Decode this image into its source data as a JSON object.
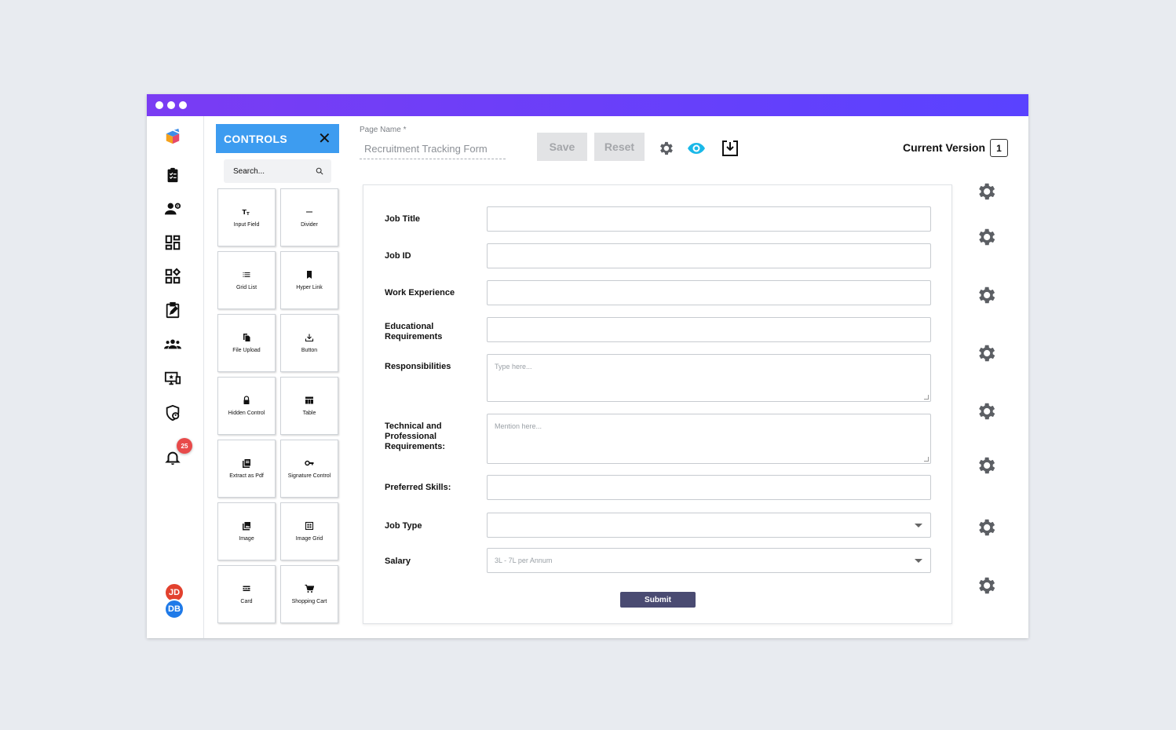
{
  "window": {
    "accent": "#6a3ef8"
  },
  "rail": {
    "icons": [
      "app-logo-icon",
      "clipboard-checklist-icon",
      "user-settings-icon",
      "dashboard-icon",
      "widgets-icon",
      "edit-task-icon",
      "team-icon",
      "monitor-star-icon",
      "shield-user-icon",
      "bell-icon"
    ],
    "notification_count": "25",
    "avatars": [
      {
        "initials": "JD",
        "color": "#e2412e"
      },
      {
        "initials": "DB",
        "color": "#1f7ae8"
      }
    ]
  },
  "controls": {
    "title": "CONTROLS",
    "close_icon": "close-icon",
    "search_placeholder": "Search...",
    "items": [
      {
        "label": "Input Field",
        "icon": "text-icon"
      },
      {
        "label": "Divider",
        "icon": "divider-icon"
      },
      {
        "label": "Grid List",
        "icon": "list-icon"
      },
      {
        "label": "Hyper Link",
        "icon": "bookmark-icon"
      },
      {
        "label": "File Upload",
        "icon": "file-copy-icon"
      },
      {
        "label": "Button",
        "icon": "download-icon"
      },
      {
        "label": "Hidden Control",
        "icon": "lock-icon"
      },
      {
        "label": "Table",
        "icon": "table-icon"
      },
      {
        "label": "Extract as Pdf",
        "icon": "pdf-icon"
      },
      {
        "label": "Signature Control",
        "icon": "key-icon"
      },
      {
        "label": "Image",
        "icon": "image-icon"
      },
      {
        "label": "Image Grid",
        "icon": "image-grid-icon"
      },
      {
        "label": "Card",
        "icon": "card-icon"
      },
      {
        "label": "Shopping Cart",
        "icon": "cart-icon"
      }
    ]
  },
  "toolbar": {
    "page_name_label": "Page Name *",
    "page_name_value": "Recruitment Tracking Form",
    "save_label": "Save",
    "reset_label": "Reset",
    "icons": [
      "gear-icon",
      "eye-icon",
      "import-icon"
    ],
    "version_label": "Current Version",
    "version_number": "1"
  },
  "form": {
    "fields": [
      {
        "label": "Job Title",
        "type": "input",
        "placeholder": ""
      },
      {
        "label": "Job ID",
        "type": "input",
        "placeholder": ""
      },
      {
        "label": "Work Experience",
        "type": "input",
        "placeholder": ""
      },
      {
        "label": "Educational Requirements",
        "type": "input",
        "placeholder": ""
      },
      {
        "label": "Responsibilities",
        "type": "textarea",
        "placeholder": "Type here..."
      },
      {
        "label": "Technical and Professional Requirements:",
        "type": "textarea",
        "placeholder": "Mention here..."
      },
      {
        "label": "Preferred Skills:",
        "type": "input",
        "placeholder": ""
      },
      {
        "label": "Job Type",
        "type": "select",
        "placeholder": ""
      },
      {
        "label": "Salary",
        "type": "select",
        "placeholder": "3L - 7L per Annum"
      }
    ],
    "submit_label": "Submit"
  },
  "field_settings_icon": "gear-icon"
}
